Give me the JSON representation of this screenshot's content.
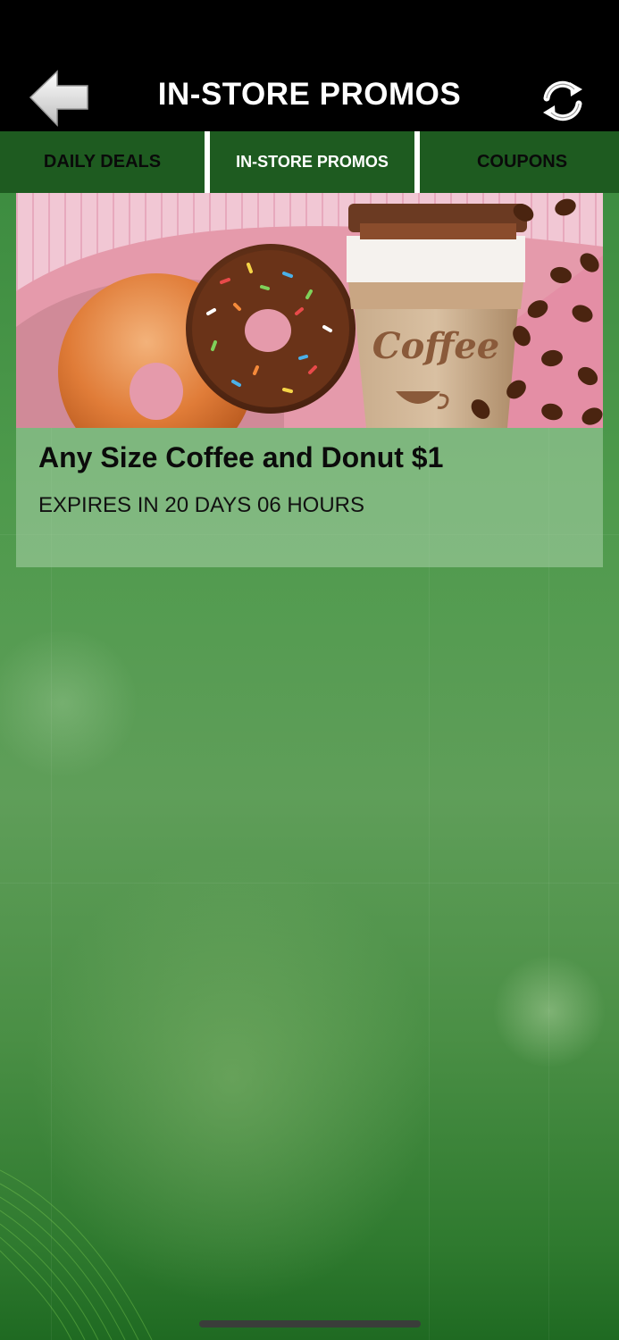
{
  "header": {
    "title": "IN-STORE PROMOS",
    "back_icon": "back-arrow-icon",
    "refresh_icon": "refresh-icon"
  },
  "tabs": [
    {
      "label": "DAILY DEALS",
      "active": false
    },
    {
      "label": "IN-STORE PROMOS",
      "active": true
    },
    {
      "label": "COUPONS",
      "active": false
    }
  ],
  "promos": [
    {
      "title": "Any Size Coffee and Donut $1",
      "expiry": "EXPIRES IN 20 DAYS 06 HOURS",
      "image_text": "Coffee"
    }
  ],
  "colors": {
    "header_bg": "#000000",
    "tab_bg": "#1e5b20",
    "page_green": "#4e9a4c"
  }
}
